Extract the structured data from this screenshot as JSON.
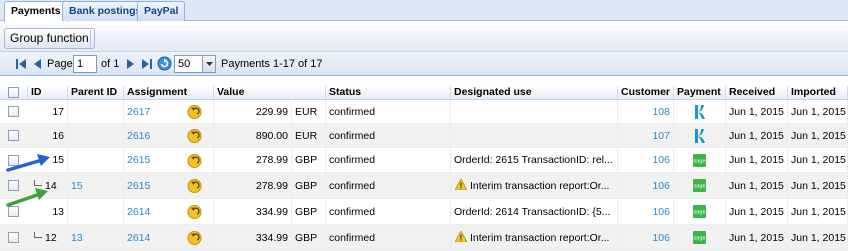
{
  "tabs": [
    {
      "label": "Payments",
      "active": true
    },
    {
      "label": "Bank postings",
      "active": false
    },
    {
      "label": "PayPal",
      "active": false
    }
  ],
  "toolbar": {
    "group_function_label": "Group function"
  },
  "pager": {
    "page_label": "Page",
    "page_value": "1",
    "of_label": "of 1",
    "page_size": "50",
    "summary": "Payments 1-17 of 17"
  },
  "grid": {
    "columns": {
      "id": "ID",
      "parent_id": "Parent ID",
      "assignment": "Assignment",
      "value": "Value",
      "status": "Status",
      "designated_use": "Designated use",
      "customer": "Customer",
      "payment": "Payment",
      "received": "Received",
      "imported": "Imported"
    },
    "rows": [
      {
        "id": "17",
        "parent_id": "",
        "assignment": "2617",
        "value": "229.99",
        "currency": "EUR",
        "status": "confirmed",
        "designated_use": "",
        "customer": "108",
        "payment_icon": "klarna-icon",
        "received": "Jun 1, 2015",
        "imported": "Jun 1, 2015"
      },
      {
        "id": "16",
        "parent_id": "",
        "assignment": "2616",
        "value": "890.00",
        "currency": "EUR",
        "status": "confirmed",
        "designated_use": "",
        "customer": "107",
        "payment_icon": "klarna-icon",
        "received": "Jun 1, 2015",
        "imported": "Jun 1, 2015"
      },
      {
        "id": "15",
        "parent_id": "",
        "assignment": "2615",
        "value": "278.99",
        "currency": "GBP",
        "status": "confirmed",
        "designated_use": "OrderId: 2615 TransactionID: rel...",
        "customer": "106",
        "payment_icon": "sage-icon",
        "received": "Jun 1, 2015",
        "imported": "Jun 1, 2015"
      },
      {
        "id": "14",
        "parent_id": "15",
        "assignment": "2615",
        "value": "278.99",
        "currency": "GBP",
        "status": "confirmed",
        "designated_use": "Interim transaction report:Or...",
        "customer": "106",
        "payment_icon": "sage-icon",
        "received": "Jun 1, 2015",
        "imported": "Jun 1, 2015"
      },
      {
        "id": "13",
        "parent_id": "",
        "assignment": "2614",
        "value": "334.99",
        "currency": "GBP",
        "status": "confirmed",
        "designated_use": "OrderId: 2614 TransactionID: {5...",
        "customer": "106",
        "payment_icon": "sage-icon",
        "received": "Jun 1, 2015",
        "imported": "Jun 1, 2015"
      },
      {
        "id": "12",
        "parent_id": "13",
        "assignment": "2614",
        "value": "334.99",
        "currency": "GBP",
        "status": "confirmed",
        "designated_use": "Interim transaction report:Or...",
        "customer": "106",
        "payment_icon": "sage-icon",
        "received": "Jun 1, 2015",
        "imported": "Jun 1, 2015"
      }
    ]
  },
  "colors": {
    "link": "#2a8cc7",
    "klarna": "#1a96d4",
    "sage": "#3cb44a",
    "annotation_blue": "#2561d6",
    "annotation_green": "#3aa33a"
  }
}
